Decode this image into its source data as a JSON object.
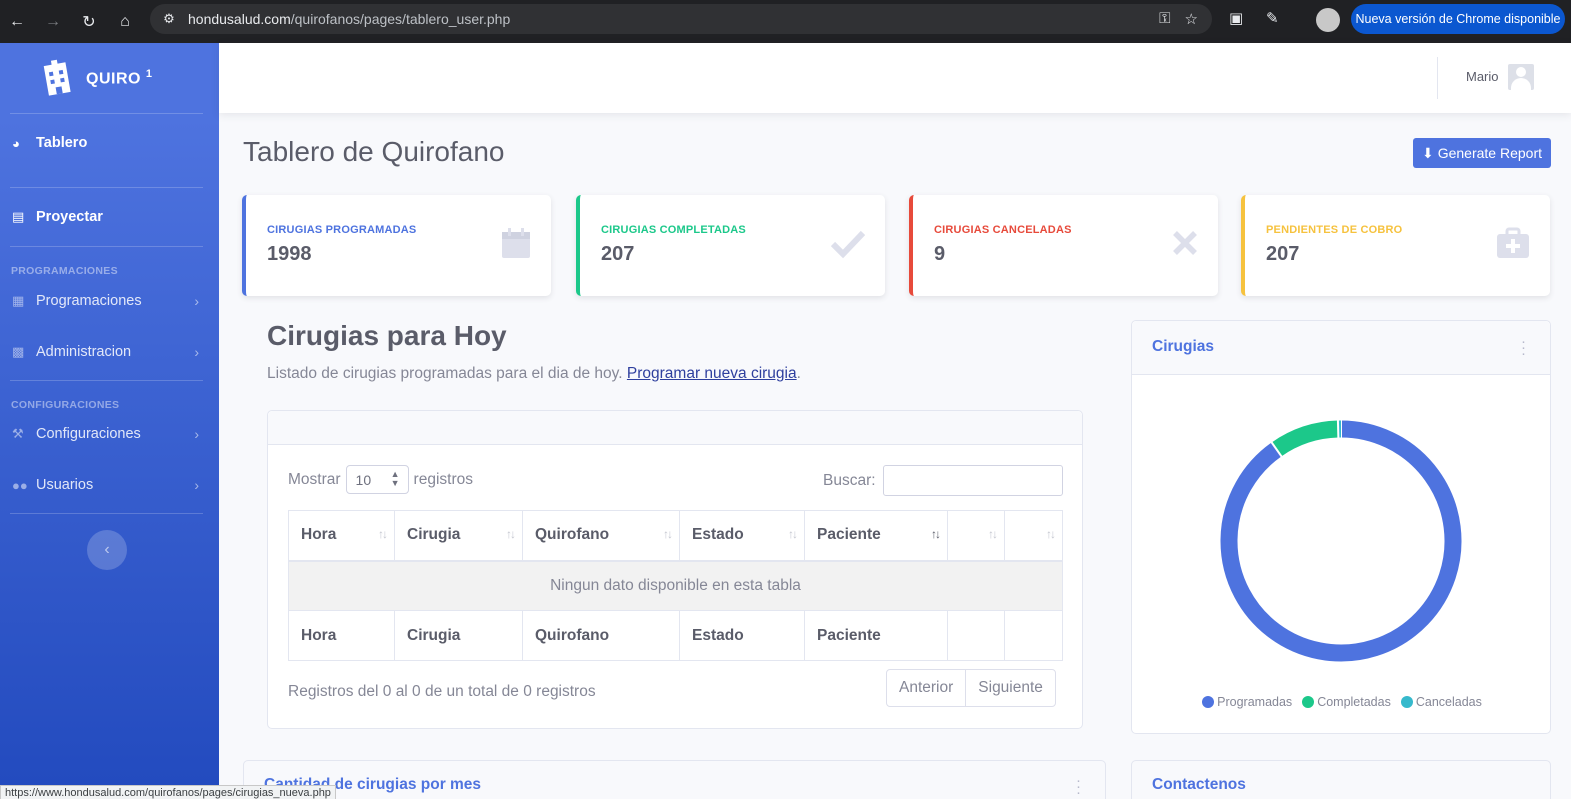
{
  "browser": {
    "url_host": "hondusalud.com",
    "url_path": "/quirofanos/pages/tablero_user.php",
    "update_label": "Nueva versión de Chrome disponible",
    "status_url": "https://www.hondusalud.com/quirofanos/pages/cirugias_nueva.php"
  },
  "sidebar": {
    "brand": "QUIRO",
    "brand_sup": "1",
    "items": {
      "tablero": "Tablero",
      "proyectar": "Proyectar",
      "programaciones": "Programaciones",
      "administracion": "Administracion",
      "configuraciones": "Configuraciones",
      "usuarios": "Usuarios"
    },
    "headings": {
      "programaciones": "PROGRAMACIONES",
      "configuraciones": "CONFIGURACIONES"
    }
  },
  "topbar": {
    "user_name": "Mario"
  },
  "page": {
    "title": "Tablero de Quirofano",
    "report_button": "Generate Report"
  },
  "stats": [
    {
      "label": "CIRUGIAS PROGRAMADAS",
      "value": "1998",
      "color": "#4e73df",
      "icon": "calendar-icon"
    },
    {
      "label": "CIRUGIAS COMPLETADAS",
      "value": "207",
      "color": "#1cc88a",
      "icon": "check-icon"
    },
    {
      "label": "CIRUGIAS CANCELADAS",
      "value": "9",
      "color": "#e74a3b",
      "icon": "times-icon"
    },
    {
      "label": "PENDIENTES DE COBRO",
      "value": "207",
      "color": "#f6c23e",
      "icon": "medkit-icon"
    }
  ],
  "today": {
    "title": "Cirugias para Hoy",
    "desc": "Listado de cirugias programadas para el dia de hoy.",
    "link": "Programar nueva cirugia",
    "link_after": "."
  },
  "datatable": {
    "show_label": "Mostrar",
    "page_size": "10",
    "records_label": "registros",
    "search_label": "Buscar:",
    "columns": [
      "Hora",
      "Cirugia",
      "Quirofano",
      "Estado",
      "Paciente",
      "",
      ""
    ],
    "empty": "Ningun dato disponible en esta tabla",
    "info": "Registros del 0 al 0 de un total de 0 registros",
    "prev": "Anterior",
    "next": "Siguiente"
  },
  "chart_card": {
    "title": "Cirugias"
  },
  "chart_data": {
    "type": "pie",
    "categories": [
      "Programadas",
      "Completadas",
      "Canceladas"
    ],
    "values": [
      1998,
      207,
      9
    ],
    "colors": [
      "#4e73df",
      "#1cc88a",
      "#36b9cc"
    ],
    "legend": "bottom"
  },
  "bottom": {
    "left_title": "Cantidad de cirugias por mes",
    "right_title": "Contactenos"
  }
}
